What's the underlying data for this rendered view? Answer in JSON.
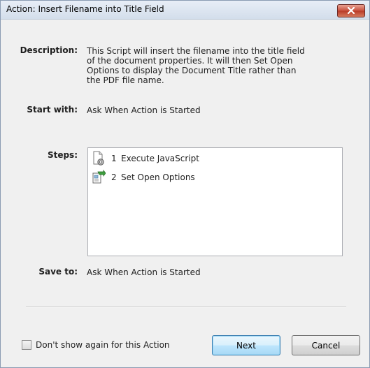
{
  "window": {
    "title": "Action: Insert Filename into Title Field",
    "close_icon": "close-x-icon"
  },
  "description": {
    "label": "Description:",
    "lines": [
      "This Script will insert the filename into the title field",
      "of the document properties. It will then Set Open",
      "Options to display the Document Title rather than",
      "the PDF file name."
    ]
  },
  "start_with": {
    "label": "Start with:",
    "value": "Ask When Action is Started"
  },
  "steps": {
    "label": "Steps:",
    "items": [
      {
        "number": "1",
        "label": "Execute JavaScript",
        "icon": "javascript-script-icon"
      },
      {
        "number": "2",
        "label": "Set Open Options",
        "icon": "open-options-icon"
      }
    ]
  },
  "save_to": {
    "label": "Save to:",
    "value": "Ask When Action is Started"
  },
  "footer": {
    "checkbox_label": "Don't show again for this Action",
    "checkbox_checked": false,
    "next_label": "Next",
    "cancel_label": "Cancel"
  },
  "colors": {
    "dialog_bg": "#f0f0f0",
    "close_button": "#c8503d",
    "default_button_border": "#3c7fb1"
  }
}
